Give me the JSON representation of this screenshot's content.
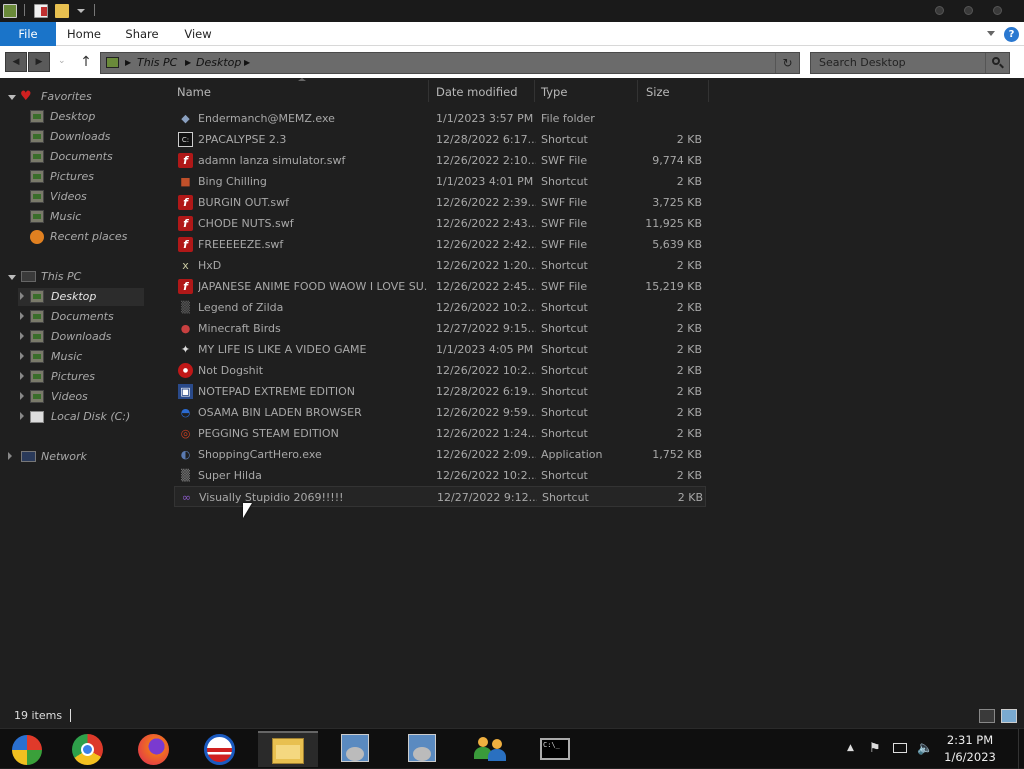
{
  "window": {
    "tabs": {
      "file": "File",
      "home": "Home",
      "share": "Share",
      "view": "View"
    },
    "help_label": "?"
  },
  "address": {
    "crumbs": [
      "This PC",
      "Desktop"
    ],
    "search_placeholder": "Search Desktop"
  },
  "nav": {
    "favorites_label": "Favorites",
    "favorites": [
      "Desktop",
      "Downloads",
      "Documents",
      "Pictures",
      "Videos",
      "Music",
      "Recent places"
    ],
    "thispc_label": "This PC",
    "thispc": [
      "Desktop",
      "Documents",
      "Downloads",
      "Music",
      "Pictures",
      "Videos",
      "Local Disk (C:)"
    ],
    "network_label": "Network"
  },
  "columns": {
    "name": "Name",
    "date": "Date modified",
    "type": "Type",
    "size": "Size"
  },
  "files": [
    {
      "name": "Endermanch@MEMZ.exe",
      "date": "1/1/2023 3:57 PM",
      "type": "File folder",
      "size": "",
      "icon": "diamond-icon",
      "color": "#8aa0c0"
    },
    {
      "name": "2PACALYPSE 2.3",
      "date": "12/28/2022 6:17...",
      "type": "Shortcut",
      "size": "2 KB",
      "icon": "cmd-icon",
      "color": "#dddddd"
    },
    {
      "name": "adamn lanza simulator.swf",
      "date": "12/26/2022 2:10...",
      "type": "SWF File",
      "size": "9,774 KB",
      "icon": "flash-icon",
      "color": "#b01818"
    },
    {
      "name": "Bing Chilling",
      "date": "1/1/2023 4:01 PM",
      "type": "Shortcut",
      "size": "2 KB",
      "icon": "bing-icon",
      "color": "#c0502a"
    },
    {
      "name": "BURGIN OUT.swf",
      "date": "12/26/2022 2:39...",
      "type": "SWF File",
      "size": "3,725 KB",
      "icon": "flash-icon",
      "color": "#b01818"
    },
    {
      "name": "CHODE NUTS.swf",
      "date": "12/26/2022 2:43...",
      "type": "SWF File",
      "size": "11,925 KB",
      "icon": "flash-icon",
      "color": "#b01818"
    },
    {
      "name": "FREEEEEZE.swf",
      "date": "12/26/2022 2:42...",
      "type": "SWF File",
      "size": "5,639 KB",
      "icon": "flash-icon",
      "color": "#b01818"
    },
    {
      "name": "HxD",
      "date": "12/26/2022 1:20...",
      "type": "Shortcut",
      "size": "2 KB",
      "icon": "hex-icon",
      "color": "#c8c8a0"
    },
    {
      "name": "JAPANESE ANIME FOOD WAOW I LOVE SU...",
      "date": "12/26/2022 2:45...",
      "type": "SWF File",
      "size": "15,219 KB",
      "icon": "flash-icon",
      "color": "#b01818"
    },
    {
      "name": "Legend of Zilda",
      "date": "12/26/2022 10:2...",
      "type": "Shortcut",
      "size": "2 KB",
      "icon": "game-icon",
      "color": "#6a6a6a"
    },
    {
      "name": "Minecraft Birds",
      "date": "12/27/2022 9:15...",
      "type": "Shortcut",
      "size": "2 KB",
      "icon": "bird-icon",
      "color": "#c84040"
    },
    {
      "name": "MY LIFE IS LIKE A VIDEO GAME",
      "date": "1/1/2023 4:05 PM",
      "type": "Shortcut",
      "size": "2 KB",
      "icon": "gamepad-icon",
      "color": "#dddddd"
    },
    {
      "name": "Not Dogshit",
      "date": "12/26/2022 10:2...",
      "type": "Shortcut",
      "size": "2 KB",
      "icon": "red-circle-icon",
      "color": "#c01818"
    },
    {
      "name": "NOTEPAD EXTREME EDITION",
      "date": "12/28/2022 6:19...",
      "type": "Shortcut",
      "size": "2 KB",
      "icon": "notepad-icon",
      "color": "#2a4a8a"
    },
    {
      "name": "OSAMA BIN LADEN BROWSER",
      "date": "12/26/2022 9:59...",
      "type": "Shortcut",
      "size": "2 KB",
      "icon": "browser-icon",
      "color": "#2a6ad0"
    },
    {
      "name": "PEGGING STEAM EDITION",
      "date": "12/26/2022 1:24...",
      "type": "Shortcut",
      "size": "2 KB",
      "icon": "chrome-icon",
      "color": "#d04020"
    },
    {
      "name": "ShoppingCartHero.exe",
      "date": "12/26/2022 2:09...",
      "type": "Application",
      "size": "1,752 KB",
      "icon": "app-icon",
      "color": "#5a7ab0"
    },
    {
      "name": "Super Hilda",
      "date": "12/26/2022 10:2...",
      "type": "Shortcut",
      "size": "2 KB",
      "icon": "game-icon",
      "color": "#8a8a8a"
    },
    {
      "name": "Visually Stupidio 2069!!!!!",
      "date": "12/27/2022 9:12...",
      "type": "Shortcut",
      "size": "2 KB",
      "icon": "visual-studio-icon",
      "color": "#8a5ac8"
    }
  ],
  "status": {
    "item_count": "19 items"
  },
  "taskbar": {
    "apps": [
      "start-orb",
      "chrome",
      "firefox",
      "obama-browser",
      "file-explorer",
      "installer",
      "installer",
      "network-users",
      "command-prompt"
    ],
    "time": "2:31 PM",
    "date": "1/6/2023"
  }
}
